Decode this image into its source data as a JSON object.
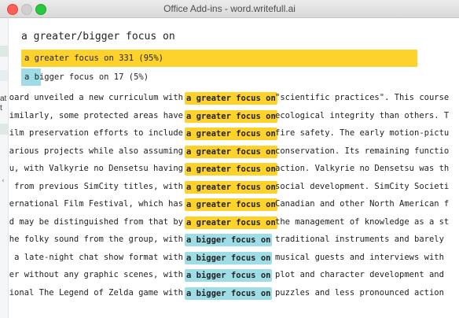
{
  "window": {
    "title": "Office Add-ins - word.writefull.ai"
  },
  "gutter": {
    "cut_text_1": "at",
    "cut_text_2": "t"
  },
  "query": "a greater/bigger focus on",
  "variants": [
    {
      "label": "a greater focus on 331 (95%)",
      "variant": "greater",
      "count": 331,
      "percent": 95
    },
    {
      "label": "a bigger focus on 17 (5%)",
      "variant": "bigger",
      "count": 17,
      "percent": 5
    }
  ],
  "examples": [
    {
      "left": "Board unveiled a new curriculum with",
      "phrase": "a greater focus on",
      "right": "\"scientific practices\". This course is",
      "type": "greater"
    },
    {
      "left": "Similarly, some protected areas have",
      "phrase": "a greater focus on",
      "right": "ecological integrity than others. The",
      "type": "greater"
    },
    {
      "left": "film preservation efforts to include",
      "phrase": "a greater focus on",
      "right": "fire safety. The early motion-picture",
      "type": "greater"
    },
    {
      "left": "various projects while also assuming",
      "phrase": "a greater focus on",
      "right": "conservation. Its remaining functions",
      "type": "greater"
    },
    {
      "left": "tsu, with Valkyrie no Densetsu having",
      "phrase": "a greater focus on",
      "right": "action. Valkyrie no Densetsu was the",
      "type": "greater"
    },
    {
      "left": "t from previous SimCity titles, with",
      "phrase": "a greater focus on",
      "right": "social development. SimCity Societies",
      "type": "greater"
    },
    {
      "left": "nternational Film Festival, which has",
      "phrase": "a greater focus on",
      "right": "Canadian and other North American fil",
      "type": "greater"
    },
    {
      "left": "nd may be distinguished from that by",
      "phrase": "a greater focus on",
      "right": "the management of knowledge as a str",
      "type": "greater"
    },
    {
      "left": "the folky sound from the group, with",
      "phrase": "a bigger focus on",
      "right": "traditional instruments and barely us",
      "type": "bigger"
    },
    {
      "left": "n a late-night chat show format with",
      "phrase": "a bigger focus on",
      "right": "musical guests and interviews with th",
      "type": "bigger"
    },
    {
      "left": "ller without any graphic scenes, with",
      "phrase": "a bigger focus on",
      "right": "plot and character development and a",
      "type": "bigger"
    },
    {
      "left": "nsional The Legend of Zelda game with",
      "phrase": "a bigger focus on",
      "right": "puzzles and less pronounced action ele",
      "type": "bigger"
    }
  ]
}
